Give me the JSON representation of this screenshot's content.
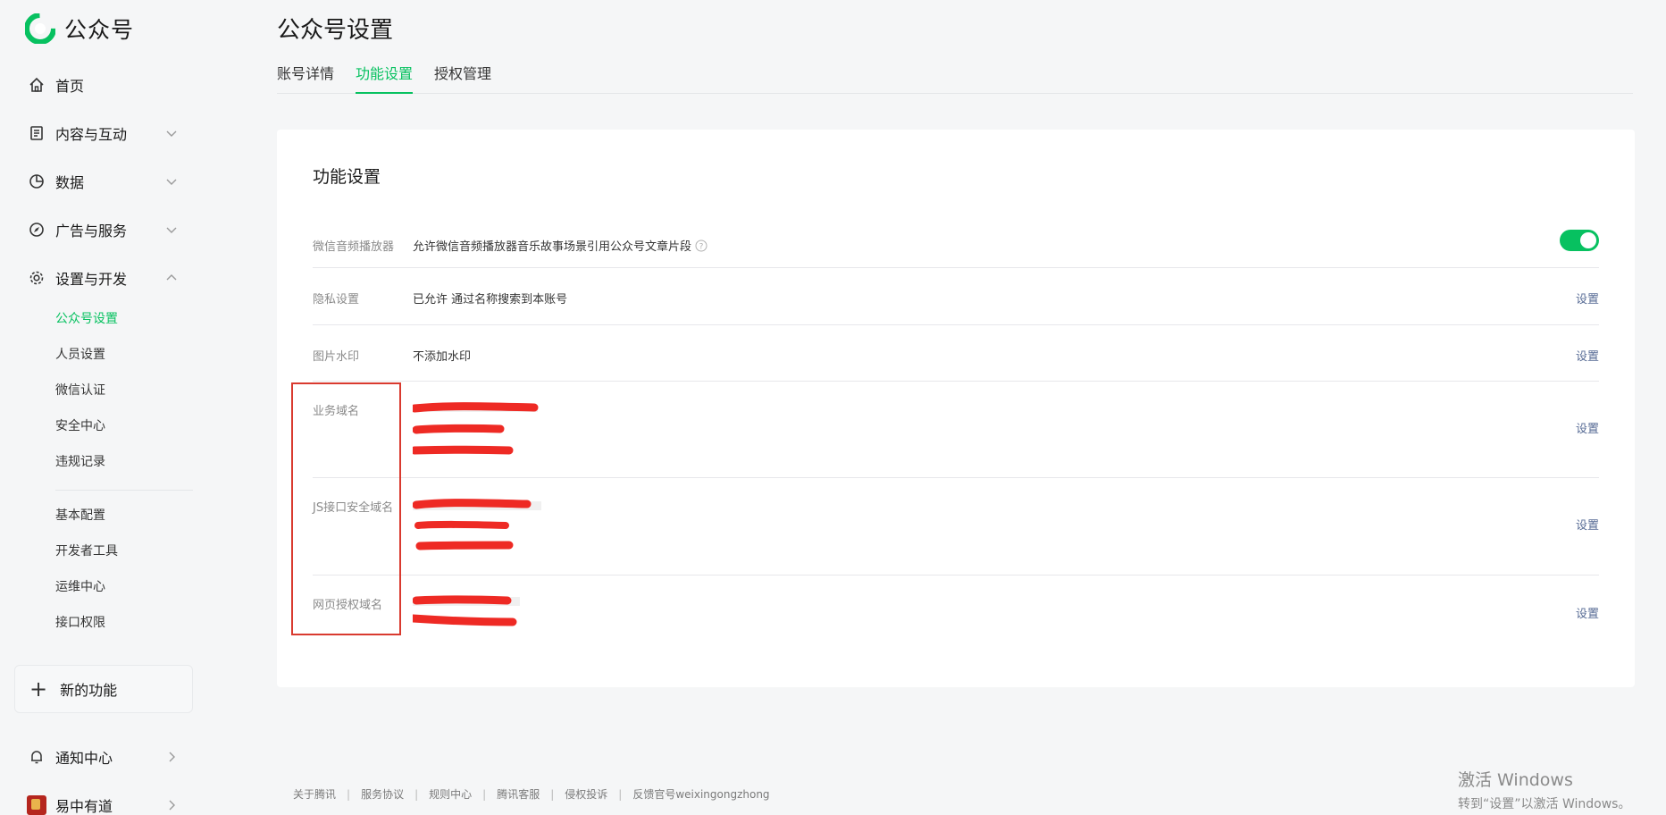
{
  "brand": {
    "name": "公众号",
    "color": "#07c160"
  },
  "sidebar": {
    "home": "首页",
    "content": "内容与互动",
    "data": "数据",
    "ads": "广告与服务",
    "settings": "设置与开发",
    "sub_items": [
      "公众号设置",
      "人员设置",
      "微信认证",
      "安全中心",
      "违规记录"
    ],
    "dev_items": [
      "基本配置",
      "开发者工具",
      "运维中心",
      "接口权限"
    ],
    "new_feature": "新的功能",
    "notifications": "通知中心",
    "account": "易中有道"
  },
  "page": {
    "title": "公众号设置",
    "tabs": [
      "账号详情",
      "功能设置",
      "授权管理"
    ],
    "active_tab": "功能设置"
  },
  "card": {
    "title": "功能设置",
    "rows": [
      {
        "label": "微信音频播放器",
        "value": "允许微信音频播放器音乐故事场景引用公众号文章片段",
        "toggle_on": true
      },
      {
        "label": "隐私设置",
        "value": "已允许 通过名称搜索到本账号",
        "action": "设置"
      },
      {
        "label": "图片水印",
        "value": "不添加水印",
        "action": "设置"
      },
      {
        "label": "业务域名",
        "action": "设置"
      },
      {
        "label": "JS接口安全域名",
        "action": "设置"
      },
      {
        "label": "网页授权域名",
        "action": "设置"
      }
    ]
  },
  "footer": {
    "links": [
      "关于腾讯",
      "服务协议",
      "规则中心",
      "腾讯客服",
      "侵权投诉",
      "反馈官号weixingongzhong"
    ]
  },
  "watermark": {
    "line1": "激活 Windows",
    "line2": "转到“设置”以激活 Windows。"
  }
}
